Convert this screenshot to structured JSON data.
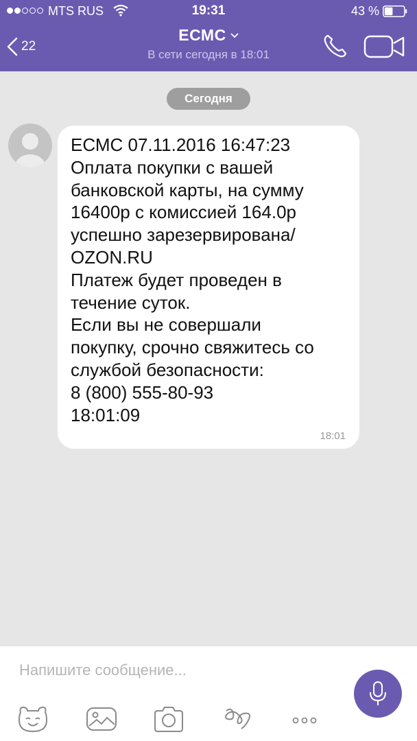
{
  "status_bar": {
    "carrier": "MTS RUS",
    "time": "19:31",
    "battery_percent": "43 %",
    "battery_level": 0.43,
    "signal_bars": 2,
    "signal_total": 5
  },
  "header": {
    "back_count": "22",
    "title": "ЕСМС",
    "subtitle": "В сети сегодня в 18:01",
    "icons": [
      "back-arrow-icon",
      "chevron-down-icon",
      "phone-icon",
      "video-camera-icon"
    ]
  },
  "chat": {
    "date_separator": "Сегодня",
    "messages": [
      {
        "lines": [
          "ЕСМС 07.11.2016 16:47:23",
          "Оплата покупки с вашей",
          "банковской карты, на сумму",
          "16400р с комиссией 164.0р",
          "успешно зарезервирована/",
          "OZON.RU",
          "Платеж будет проведен в",
          "течение суток.",
          "Если вы не совершали",
          "покупку, срочно свяжитесь со",
          "службой безопасности:",
          "8 (800) 555-80-93",
          "18:01:09"
        ],
        "time": "18:01"
      }
    ]
  },
  "composer": {
    "placeholder": "Напишите сообщение...",
    "value": "",
    "icons": [
      "microphone-icon",
      "sticker-icon",
      "gallery-icon",
      "camera-icon",
      "doodle-icon",
      "more-icon"
    ]
  },
  "colors": {
    "header_bg": "#6a5bb1",
    "chat_bg": "#e6e6e6",
    "bubble_bg": "#ffffff",
    "date_pill_bg": "#9e9e9e",
    "icon_gray": "#8a8a8a"
  }
}
